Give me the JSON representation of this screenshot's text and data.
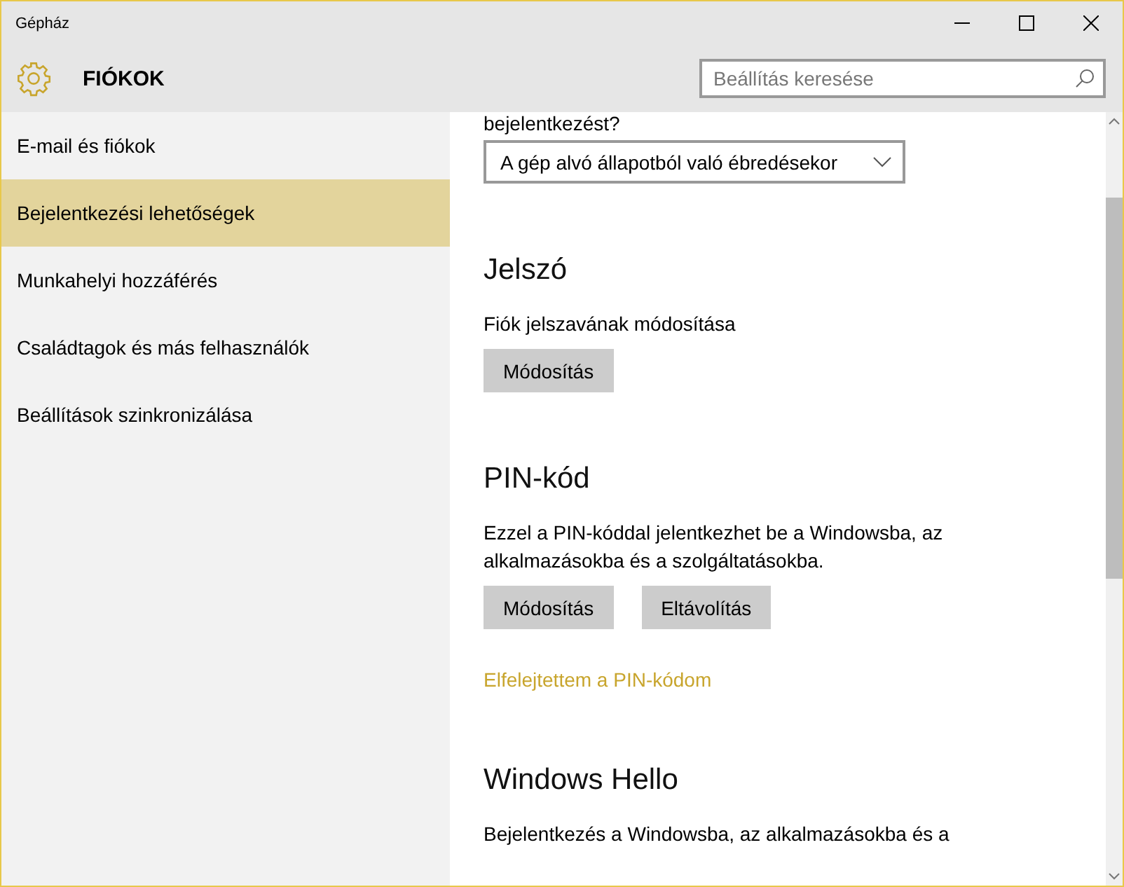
{
  "window": {
    "title": "Gépház"
  },
  "header": {
    "title": "FIÓKOK",
    "search": {
      "placeholder": "Beállítás keresése"
    }
  },
  "sidebar": {
    "items": [
      {
        "label": "E-mail és fiókok",
        "selected": false
      },
      {
        "label": "Bejelentkezési lehetőségek",
        "selected": true
      },
      {
        "label": "Munkahelyi hozzáférés",
        "selected": false
      },
      {
        "label": "Családtagok és más felhasználók",
        "selected": false
      },
      {
        "label": "Beállítások szinkronizálása",
        "selected": false
      }
    ]
  },
  "content": {
    "question_tail": "bejelentkezést?",
    "dropdown": {
      "value": "A gép alvó állapotból való ébredésekor"
    },
    "sections": [
      {
        "heading": "Jelszó",
        "text": "Fiók jelszavának módosítása",
        "buttons": [
          "Módosítás"
        ]
      },
      {
        "heading": "PIN-kód",
        "text": "Ezzel a PIN-kóddal jelentkezhet be a Windowsba, az alkalmazásokba és a szolgáltatásokba.",
        "buttons": [
          "Módosítás",
          "Eltávolítás"
        ],
        "link": "Elfelejtettem a PIN-kódom"
      },
      {
        "heading": "Windows Hello",
        "text": "Bejelentkezés a Windowsba, az alkalmazásokba és a"
      }
    ]
  }
}
